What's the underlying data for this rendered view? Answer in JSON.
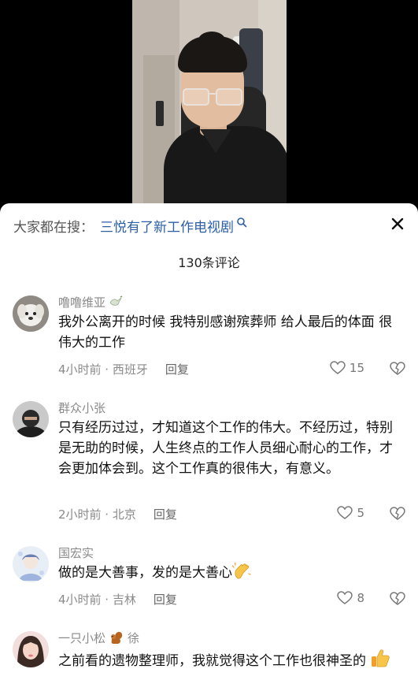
{
  "search": {
    "prefix": "大家都在搜：",
    "query": "三悦有了新工作电视剧"
  },
  "comments_count": "130条评论",
  "comments": [
    {
      "author": "噜噜维亚",
      "text": "我外公离开的时候 我特别感谢殡葬师 给人最后的体面 很伟大的工作",
      "time_location": "4小时前 · 西班牙",
      "reply_label": "回复",
      "likes": "15"
    },
    {
      "author": "群众小张",
      "text": "只有经历过过，才知道这个工作的伟大。不经历过，特别是无助的时候，人生终点的工作人员细心耐心的工作，才会更加体会到。这个工作真的很伟大，有意义。",
      "time_location": "2小时前 · 北京",
      "reply_label": "回复",
      "likes": "5"
    },
    {
      "author": "国宏实",
      "text": "做的是大善事，发的是大善心",
      "time_location": "4小时前 · 吉林",
      "reply_label": "回复",
      "likes": "8"
    },
    {
      "author": "一只小松",
      "author_suffix": "徐",
      "text": "之前看的遗物整理师，我就觉得这个工作也很神圣的",
      "time_location": "",
      "reply_label": "",
      "likes": ""
    }
  ],
  "colors": {
    "search_link": "#2b5fa8",
    "meta_gray": "#8a8a8a",
    "text": "#111111"
  },
  "icons": [
    "search-icon",
    "close-icon",
    "heart-icon",
    "broken-heart-icon",
    "dove-icon",
    "squirrel-icon",
    "clapping-hands-icon",
    "thumbs-up-icon"
  ]
}
